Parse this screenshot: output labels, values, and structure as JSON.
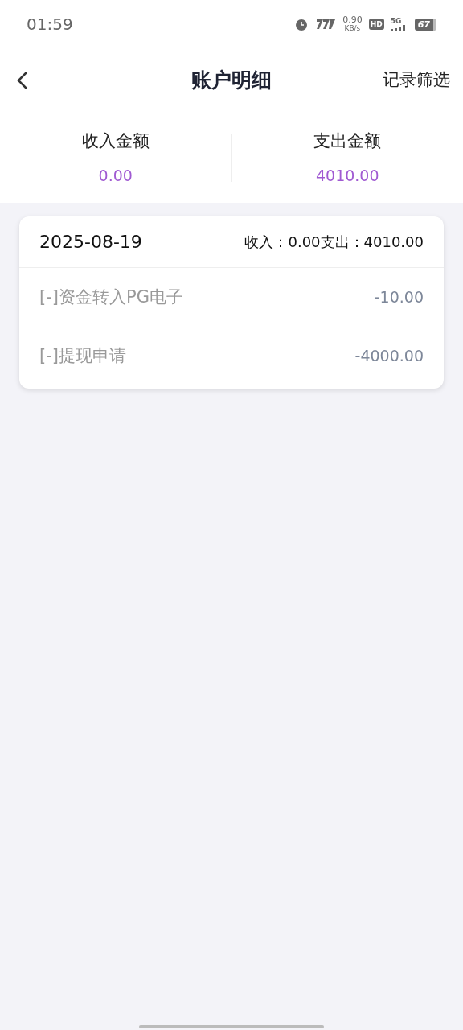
{
  "status_bar": {
    "time": "01:59",
    "speed_value": "0.90",
    "speed_unit": "KB/s",
    "hd": "HD",
    "network": "5G",
    "battery": "67"
  },
  "header": {
    "title": "账户明细",
    "action": "记录筛选"
  },
  "summary": [
    {
      "label": "收入金额",
      "amount": "0.00"
    },
    {
      "label": "支出金额",
      "amount": "4010.00"
    }
  ],
  "days": [
    {
      "date": "2025-08-19",
      "totals": "收入：0.00支出：4010.00",
      "entries": [
        {
          "description": "[-]资金转入PG电子",
          "amount": "-10.00"
        },
        {
          "description": "[-]提现申请",
          "amount": "-4000.00"
        }
      ]
    }
  ]
}
